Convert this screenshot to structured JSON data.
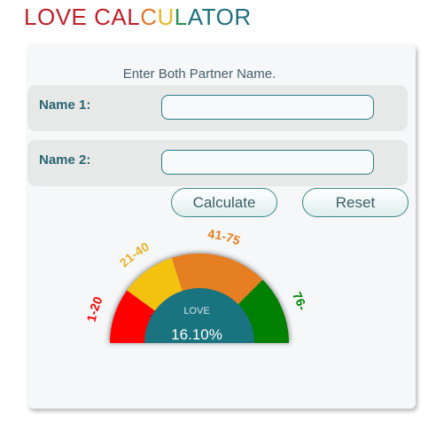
{
  "app_title": {
    "letters": [
      {
        "char": "L",
        "color": "#c0212b"
      },
      {
        "char": "O",
        "color": "#c0212b"
      },
      {
        "char": "V",
        "color": "#c0212b"
      },
      {
        "char": "E",
        "color": "#c0212b"
      },
      {
        "char": " ",
        "color": "#c0212b"
      },
      {
        "char": "C",
        "color": "#c0212b"
      },
      {
        "char": "A",
        "color": "#c0212b"
      },
      {
        "char": "L",
        "color": "#c0212b"
      },
      {
        "char": "C",
        "color": "#e0762a"
      },
      {
        "char": "U",
        "color": "#e8b820"
      },
      {
        "char": "L",
        "color": "#2f8f55"
      },
      {
        "char": "A",
        "color": "#1d6f7d"
      },
      {
        "char": "T",
        "color": "#1d6f7d"
      },
      {
        "char": "O",
        "color": "#1d6f7d"
      },
      {
        "char": "R",
        "color": "#1d6f7d"
      }
    ]
  },
  "form": {
    "instruction": "Enter Both Partner Name.",
    "name1_label": "Name 1:",
    "name1_value": "",
    "name2_label": "Name 2:",
    "name2_value": "",
    "calculate_label": "Calculate",
    "reset_label": "Reset"
  },
  "gauge": {
    "center_label": "LOVE",
    "value_text": "16.10%",
    "value_percent": 16.1,
    "segments": [
      {
        "label": "1-20",
        "color": "#ff0000",
        "label_color": "#ff0000"
      },
      {
        "label": "21-40",
        "color": "#f2c20f",
        "label_color": "#e4b323"
      },
      {
        "label": "41-75",
        "color": "#e67e22",
        "label_color": "#e67e22"
      },
      {
        "label": "76-",
        "color": "#008000",
        "label_color": "#008000"
      }
    ],
    "hub_color": "#1a7480"
  }
}
